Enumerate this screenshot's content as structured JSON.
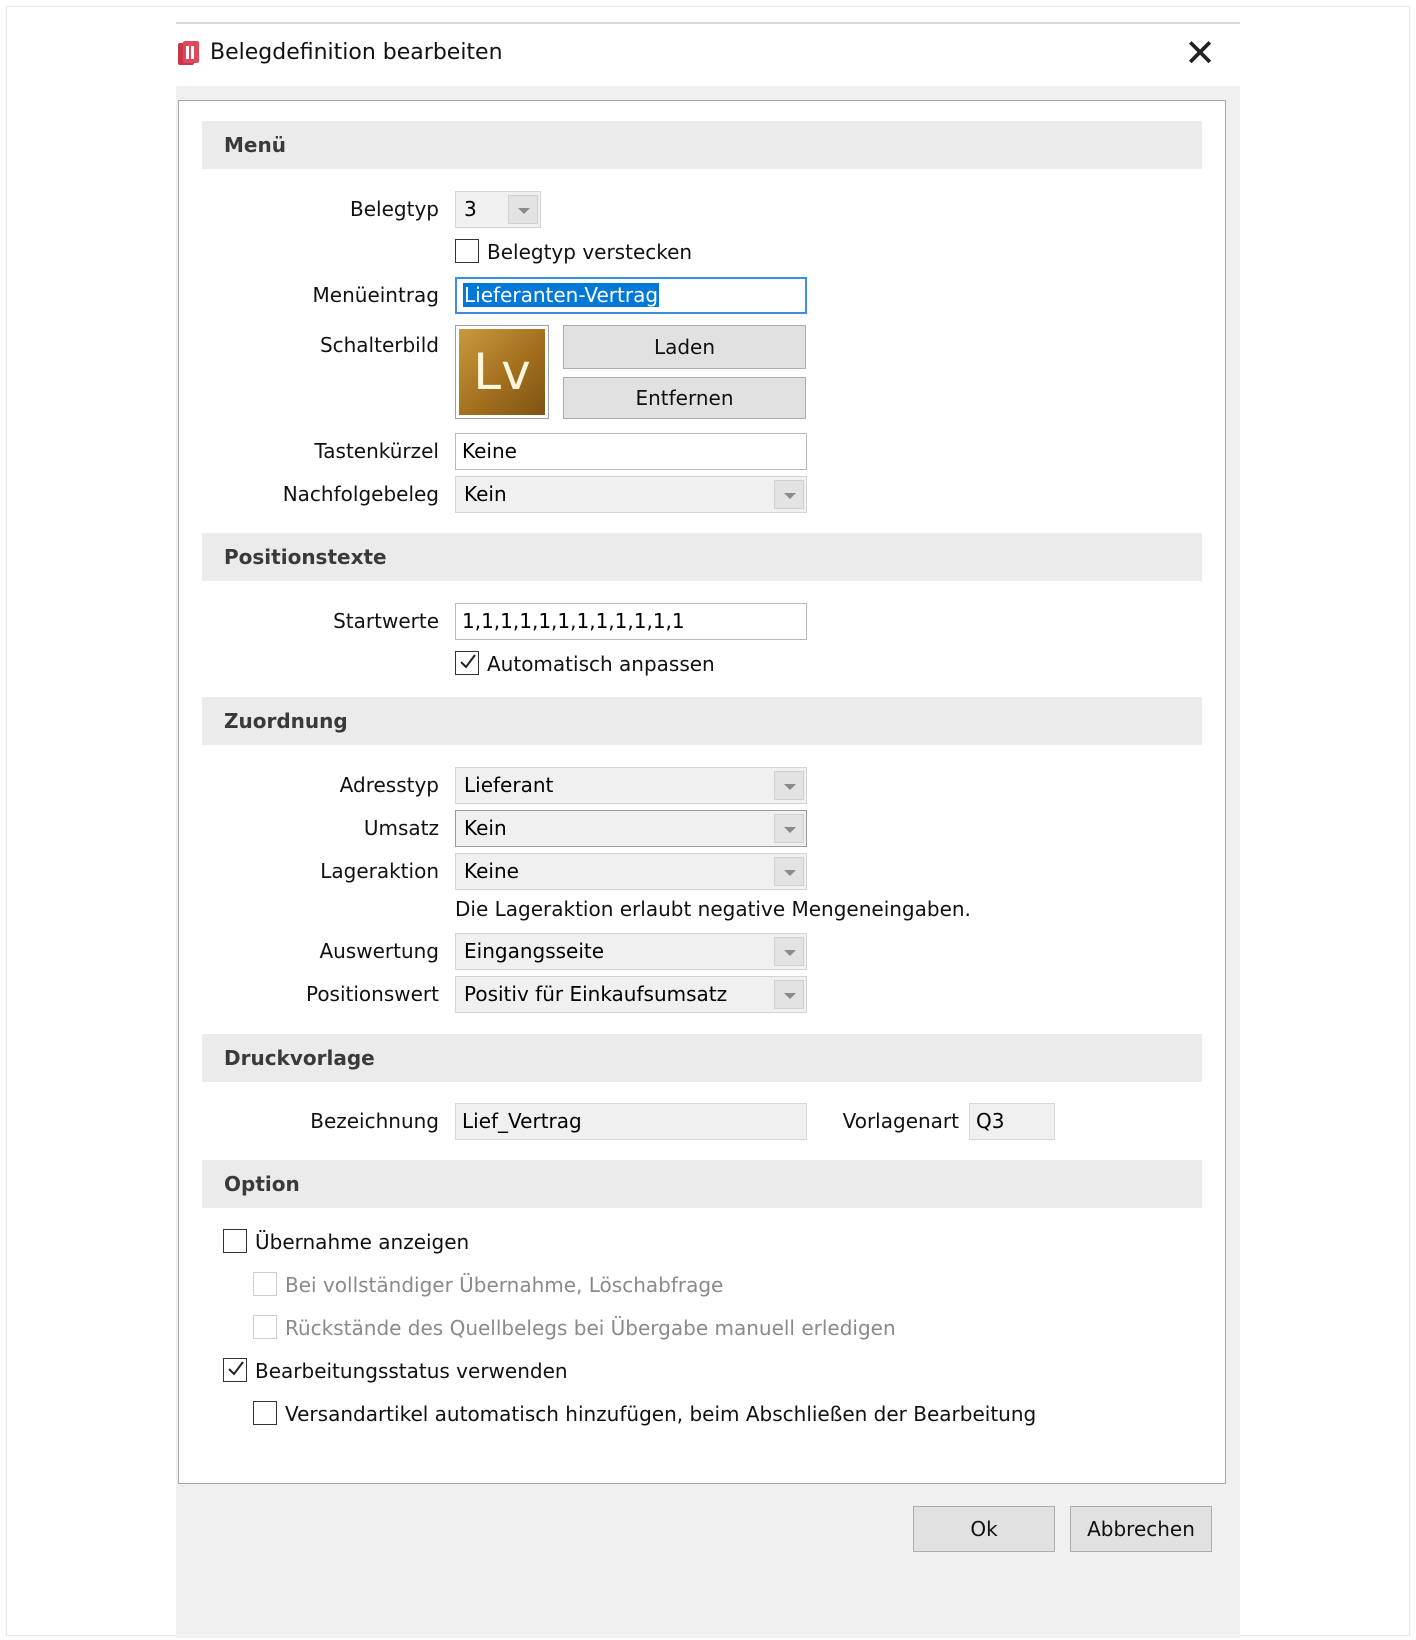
{
  "window": {
    "title": "Belegdefinition bearbeiten",
    "close_glyph": "✕",
    "icon": "app-document-icon",
    "accent_color": "#0078d7"
  },
  "menu": {
    "header": "Menü",
    "belegtyp_label": "Belegtyp",
    "belegtyp_value": "3",
    "hide_label": "Belegtyp verstecken",
    "hide_checked": false,
    "menueintrag_label": "Menüeintrag",
    "menueintrag_value": "Lieferanten-Vertrag",
    "schalterbild_label": "Schalterbild",
    "schalterbild_text": "Lv",
    "laden_label": "Laden",
    "entfernen_label": "Entfernen",
    "tastenkuerzel_label": "Tastenkürzel",
    "tastenkuerzel_value": "Keine",
    "nachfolgebeleg_label": "Nachfolgebeleg",
    "nachfolgebeleg_value": "Kein"
  },
  "positionstexte": {
    "header": "Positionstexte",
    "startwerte_label": "Startwerte",
    "startwerte_value": "1,1,1,1,1,1,1,1,1,1,1,1",
    "auto_label": "Automatisch anpassen",
    "auto_checked": true
  },
  "zuordnung": {
    "header": "Zuordnung",
    "adresstyp_label": "Adresstyp",
    "adresstyp_value": "Lieferant",
    "umsatz_label": "Umsatz",
    "umsatz_value": "Kein",
    "lageraktion_label": "Lageraktion",
    "lageraktion_value": "Keine",
    "lager_info": "Die Lageraktion erlaubt negative Mengeneingaben.",
    "auswertung_label": "Auswertung",
    "auswertung_value": "Eingangsseite",
    "positionswert_label": "Positionswert",
    "positionswert_value": "Positiv für Einkaufsumsatz"
  },
  "druckvorlage": {
    "header": "Druckvorlage",
    "bezeichnung_label": "Bezeichnung",
    "bezeichnung_value": "Lief_Vertrag",
    "vorlagenart_label": "Vorlagenart",
    "vorlagenart_value": "Q3"
  },
  "option": {
    "header": "Option",
    "uebernahme_label": "Übernahme anzeigen",
    "uebernahme_checked": false,
    "loeschabfrage_label": "Bei vollständiger Übernahme, Löschabfrage",
    "rueckstaende_label": "Rückstände des Quellbelegs bei Übergabe manuell erledigen",
    "bearbeitungsstatus_label": "Bearbeitungsstatus verwenden",
    "bearbeitungsstatus_checked": true,
    "versandartikel_label": "Versandartikel automatisch hinzufügen, beim Abschließen der Bearbeitung",
    "versandartikel_checked": false
  },
  "footer": {
    "ok_label": "Ok",
    "cancel_label": "Abbrechen"
  }
}
